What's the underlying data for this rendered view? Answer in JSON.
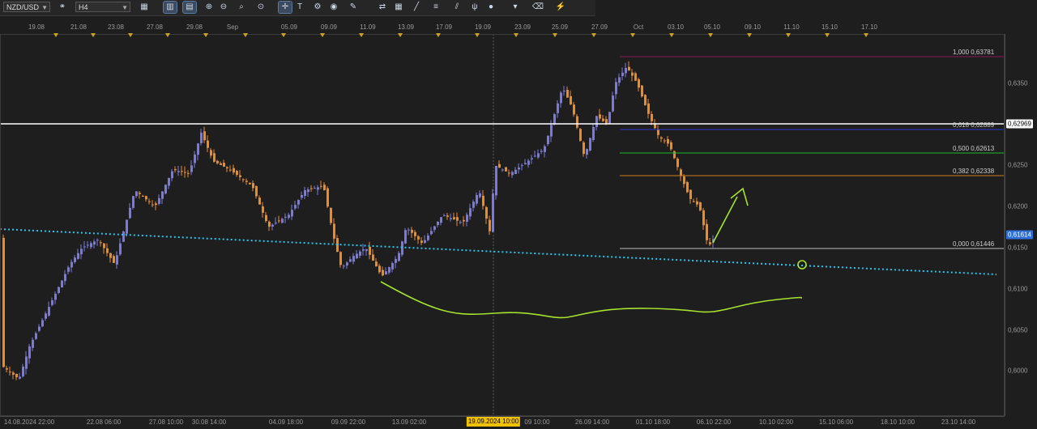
{
  "toolbar": {
    "symbol": "NZD/USD",
    "timeframe": "H4",
    "buttons": [
      {
        "name": "chart-type-icon",
        "glyph": "▦"
      },
      {
        "name": "bar-chart-icon",
        "glyph": "▥"
      },
      {
        "name": "candles-icon",
        "glyph": "▤"
      },
      {
        "name": "zoom-in-icon",
        "glyph": "⊕"
      },
      {
        "name": "zoom-out-icon",
        "glyph": "⊖"
      },
      {
        "name": "magnifier-icon",
        "glyph": "⌕"
      },
      {
        "name": "cursor-icon",
        "glyph": "⊙"
      },
      {
        "name": "crosshair-icon",
        "glyph": "✛"
      },
      {
        "name": "text-icon",
        "glyph": "T"
      },
      {
        "name": "settings-icon",
        "glyph": "⚙"
      },
      {
        "name": "globe-icon",
        "glyph": "◉"
      },
      {
        "name": "pencil-icon",
        "glyph": "✎"
      },
      {
        "name": "arrows-icon",
        "glyph": "⇄"
      },
      {
        "name": "grid-icon",
        "glyph": "▦"
      },
      {
        "name": "line-icon",
        "glyph": "╱"
      },
      {
        "name": "channel-icon",
        "glyph": "≡"
      },
      {
        "name": "fib-icon",
        "glyph": "⫽"
      },
      {
        "name": "pitchfork-icon",
        "glyph": "ψ"
      },
      {
        "name": "circle-icon",
        "glyph": "●"
      },
      {
        "name": "more-icon",
        "glyph": "▾"
      },
      {
        "name": "eraser-icon",
        "glyph": "⌫"
      },
      {
        "name": "signal-icon",
        "glyph": "⚡"
      }
    ]
  },
  "date_axis": [
    "19.08",
    "21.08",
    "23.08",
    "27.08",
    "29.08",
    "Sep",
    "05.09",
    "09.09",
    "11.09",
    "13.09",
    "17.09",
    "19.09",
    "23.09",
    "25.09",
    "27.09",
    "Oct",
    "03.10",
    "05.10",
    "09.10",
    "11.10",
    "15.10",
    "17.10"
  ],
  "time_axis": [
    "14.08.2024 22:00",
    "22.08 06:00",
    "27.08 10:00",
    "30.08 14:00",
    "04.09 18:00",
    "09.09 22:00",
    "13.09 02:00",
    "19.09.2024 10:00",
    "09 10:00",
    "26.09 14:00",
    "01.10 18:00",
    "06.10 22:00",
    "10.10 02:00",
    "15.10 06:00",
    "18.10 10:00",
    "23.10 14:00"
  ],
  "crosshair_time": "19.09.2024 10:00",
  "price_axis": [
    "0,6350",
    "0,6300",
    "0,6250",
    "0,6200",
    "0,6150",
    "0,6100",
    "0,6050",
    "0,6000"
  ],
  "badges": {
    "white_line": "0,62969",
    "current_price": "0,61614"
  },
  "fib_levels": [
    {
      "label": "1,000 0,63781",
      "value": 0.63781,
      "color": "#8b1a5a"
    },
    {
      "label": "0,618 0,62889",
      "value": 0.62889,
      "color": "#2b3bd6"
    },
    {
      "label": "0,500 0,62613",
      "value": 0.62613,
      "color": "#1db82a"
    },
    {
      "label": "0,382 0,62338",
      "value": 0.62338,
      "color": "#d07a1e"
    },
    {
      "label": "0,000 0,61446",
      "value": 0.61446,
      "color": "#bdbdbd"
    }
  ],
  "colors": {
    "bull": "#7b78e6",
    "bear": "#f08a24",
    "horizontal": "#ffffff",
    "trend": "#29c6f0",
    "drawing": "#a6e22e"
  }
}
